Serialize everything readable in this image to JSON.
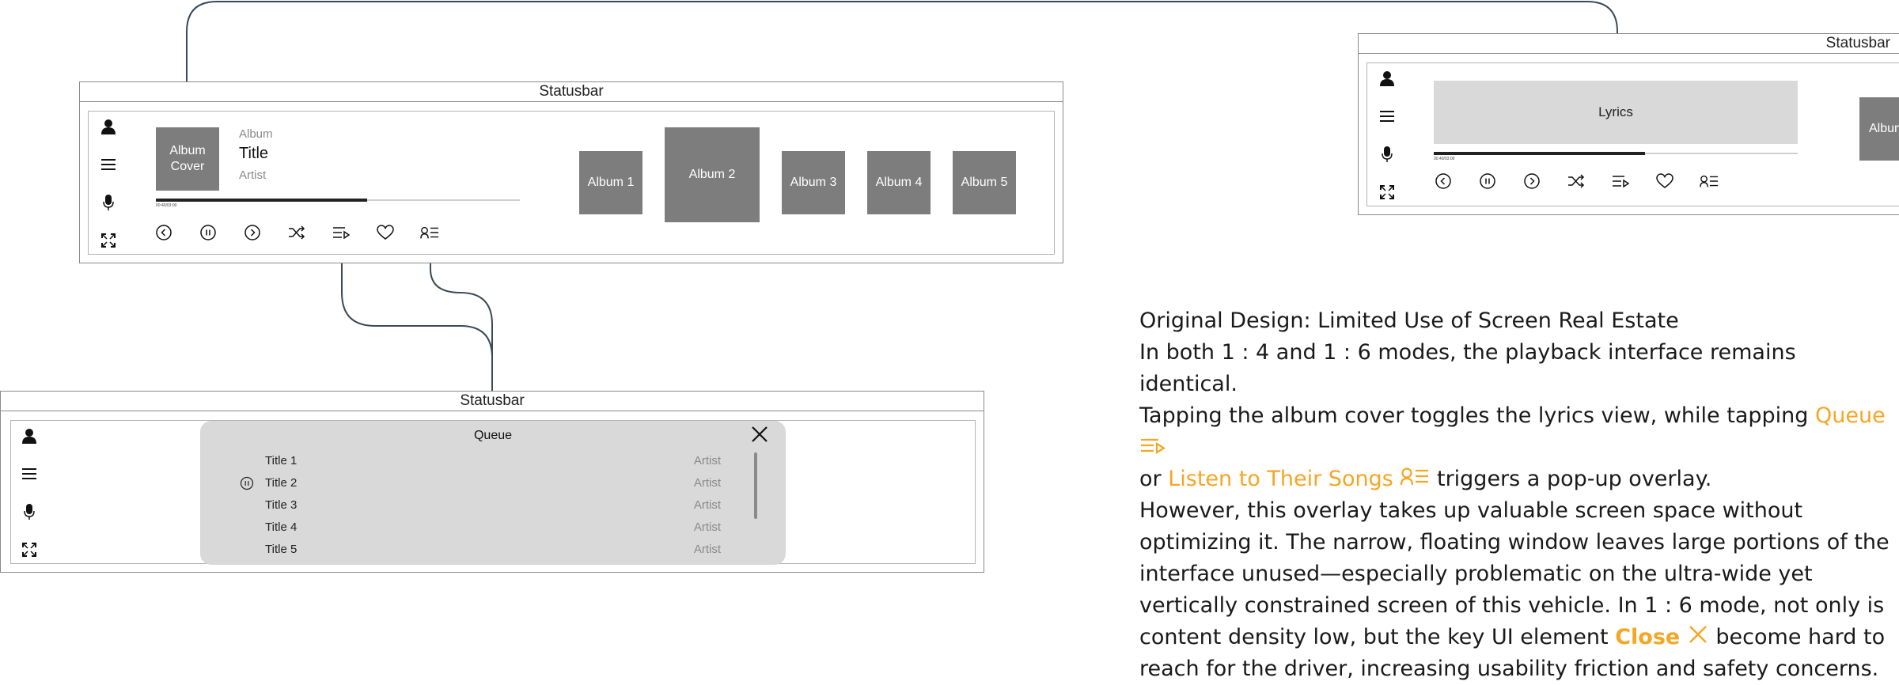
{
  "frames": {
    "main": {
      "statusbar": "Statusbar",
      "album_cover": "Album Cover",
      "album_label": "Album",
      "title": "Title",
      "artist": "Artist",
      "time": "00:40/03:00",
      "progress": 0.58,
      "albums": [
        "Album 1",
        "Album 2",
        "Album 3",
        "Album 4",
        "Album 5"
      ]
    },
    "lyrics": {
      "statusbar": "Statusbar",
      "lyrics_label": "Lyrics",
      "time": "00:40/03:00",
      "progress": 0.58,
      "partial_album": "Album"
    },
    "queue": {
      "statusbar": "Statusbar",
      "title": "Queue",
      "items": [
        {
          "title": "Title 1",
          "artist": "Artist"
        },
        {
          "title": "Title 2",
          "artist": "Artist"
        },
        {
          "title": "Title 3",
          "artist": "Artist"
        },
        {
          "title": "Title 4",
          "artist": "Artist"
        },
        {
          "title": "Title 5",
          "artist": "Artist"
        }
      ],
      "playing_index": 1
    }
  },
  "colors": {
    "accent": "#f5a623",
    "frame_border": "#8a8a8a",
    "box_fill": "#7d7d7d",
    "overlay_fill": "#d9d9d9",
    "connector": "#3b4a56"
  },
  "icons": [
    "user-icon",
    "menu-icon",
    "mic-icon",
    "fullscreen-icon",
    "prev-icon",
    "pause-icon",
    "next-icon",
    "shuffle-icon",
    "queue-icon",
    "heart-icon",
    "artist-songs-icon",
    "close-icon"
  ],
  "description": {
    "heading": "Original Design: Limited Use of Screen Real Estate",
    "p1": "In both 1 : 4 and 1 : 6 modes, the playback interface remains identical.",
    "p2_a": "Tapping the album cover toggles the lyrics view, while tapping",
    "p2_queue": "Queue",
    "p2_b": "or",
    "p2_listen": "Listen to Their Songs",
    "p2_c": "triggers a pop-up overlay.",
    "p3_a": "However, this overlay takes up valuable screen space without optimizing it. The narrow, floating window leaves large portions of the interface unused—especially problematic on the ultra-wide yet vertically constrained screen of this vehicle. In 1 : 6 mode, not only is content density low, but the key UI element",
    "p3_close": "Close",
    "p3_b": "become hard to reach for the driver, increasing usability friction and safety concerns."
  }
}
